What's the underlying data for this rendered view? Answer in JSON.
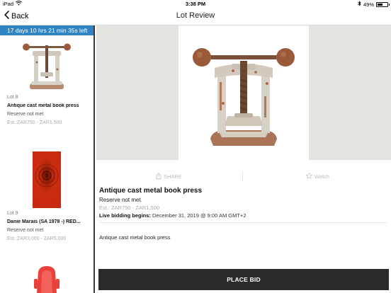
{
  "status_bar": {
    "device": "iPad",
    "time": "3:38 PM",
    "battery": "49%",
    "battery_level": 0.49,
    "icons": [
      "wifi-icon",
      "bluetooth-icon",
      "battery-icon"
    ]
  },
  "navbar": {
    "back_label": "Back",
    "title": "Lot Review"
  },
  "sidebar": {
    "countdown": "17 days 10 hrs 21 min 35s left",
    "lots": [
      {
        "lot_number": "Lot 8",
        "title": "Antique cast metal book press",
        "reserve": "Reserve not met",
        "estimate": "Est.:ZAR750 - ZAR1,500",
        "thumbnail": "book-press-image"
      },
      {
        "lot_number": "Lot 9",
        "title": "Danie Marais (SA 1978 -) RED...",
        "reserve": "Reserve not met",
        "estimate": "Est.:ZAR3,000 - ZAR5,000",
        "thumbnail": "red-painting-image"
      },
      {
        "thumbnail": "red-object-image"
      }
    ]
  },
  "actions": {
    "share_label": "SHARE",
    "watch_label": "Watch"
  },
  "lot_detail": {
    "title": "Antique cast metal book press",
    "reserve": "Reserve not met",
    "estimate": "Est.: ZAR750 - ZAR1,500",
    "live_bidding_label": "Live bidding begins:",
    "live_bidding_date": "December 31, 2019 @ 9:00 AM GMT+2",
    "description": "Antique cast metal book press"
  },
  "place_bid_label": "PLACE BID",
  "colors": {
    "countdown_bg": "#2f84c6",
    "place_bid_bg": "#2b2b2b",
    "gallery_side": "#e3e3e0",
    "muted_text": "#aaaaaa"
  }
}
